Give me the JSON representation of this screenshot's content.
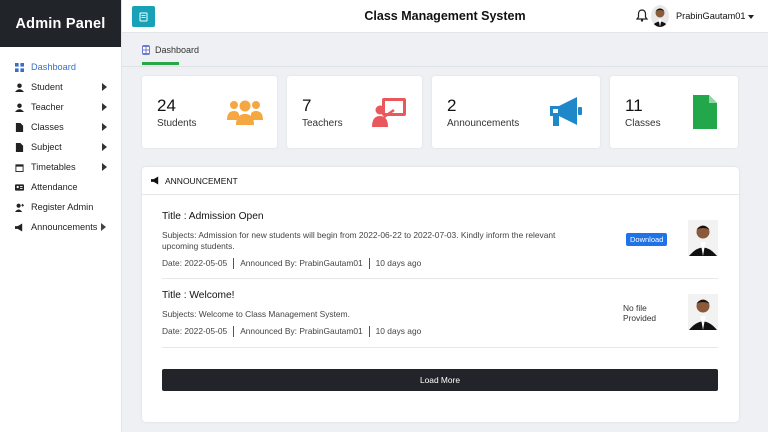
{
  "sidebar": {
    "brand": "Admin Panel",
    "items": [
      {
        "label": "Dashboard",
        "icon": "dashboard-icon"
      },
      {
        "label": "Student",
        "icon": "user-icon"
      },
      {
        "label": "Teacher",
        "icon": "user-icon"
      },
      {
        "label": "Classes",
        "icon": "file-icon"
      },
      {
        "label": "Subject",
        "icon": "file-icon"
      },
      {
        "label": "Timetables",
        "icon": "calendar-icon"
      },
      {
        "label": "Attendance",
        "icon": "id-card-icon"
      },
      {
        "label": "Register Admin",
        "icon": "user-plus-icon"
      },
      {
        "label": "Announcements",
        "icon": "megaphone-icon"
      }
    ]
  },
  "topbar": {
    "title": "Class Management System",
    "username": "PrabinGautam01"
  },
  "breadcrumb": {
    "tab": "Dashboard"
  },
  "stats": [
    {
      "value": "24",
      "label": "Students",
      "icon": "users-icon",
      "color": "#f5a742"
    },
    {
      "value": "7",
      "label": "Teachers",
      "icon": "teacher-board-icon",
      "color": "#e8585c"
    },
    {
      "value": "2",
      "label": "Announcements",
      "icon": "megaphone-icon",
      "color": "#1e88c8"
    },
    {
      "value": "11",
      "label": "Classes",
      "icon": "file-icon",
      "color": "#22a84a"
    }
  ],
  "announcements": {
    "header": "ANNOUNCEMENT",
    "items": [
      {
        "title": "Title : Admission Open",
        "subject": "Subjects: Admission for new students will begin from 2022-06-22 to 2022-07-03. Kindly inform the relevant upcoming students.",
        "date": "Date: 2022-05-05",
        "by": "Announced By: PrabinGautam01",
        "ago": "10 days ago",
        "file": "Download"
      },
      {
        "title": "Title : Welcome!",
        "subject": "Subjects: Welcome to Class Management System.",
        "date": "Date: 2022-05-05",
        "by": "Announced By: PrabinGautam01",
        "ago": "10 days ago",
        "file_line1": "No file",
        "file_line2": "Provided"
      }
    ],
    "load_more": "Load More"
  },
  "colors": {
    "sidebar_brand_bg": "#212529",
    "accent_blue": "#3b6fc4",
    "menu_button": "#17a2b8",
    "download_button": "#1e73e8",
    "active_underline": "#28a745"
  }
}
